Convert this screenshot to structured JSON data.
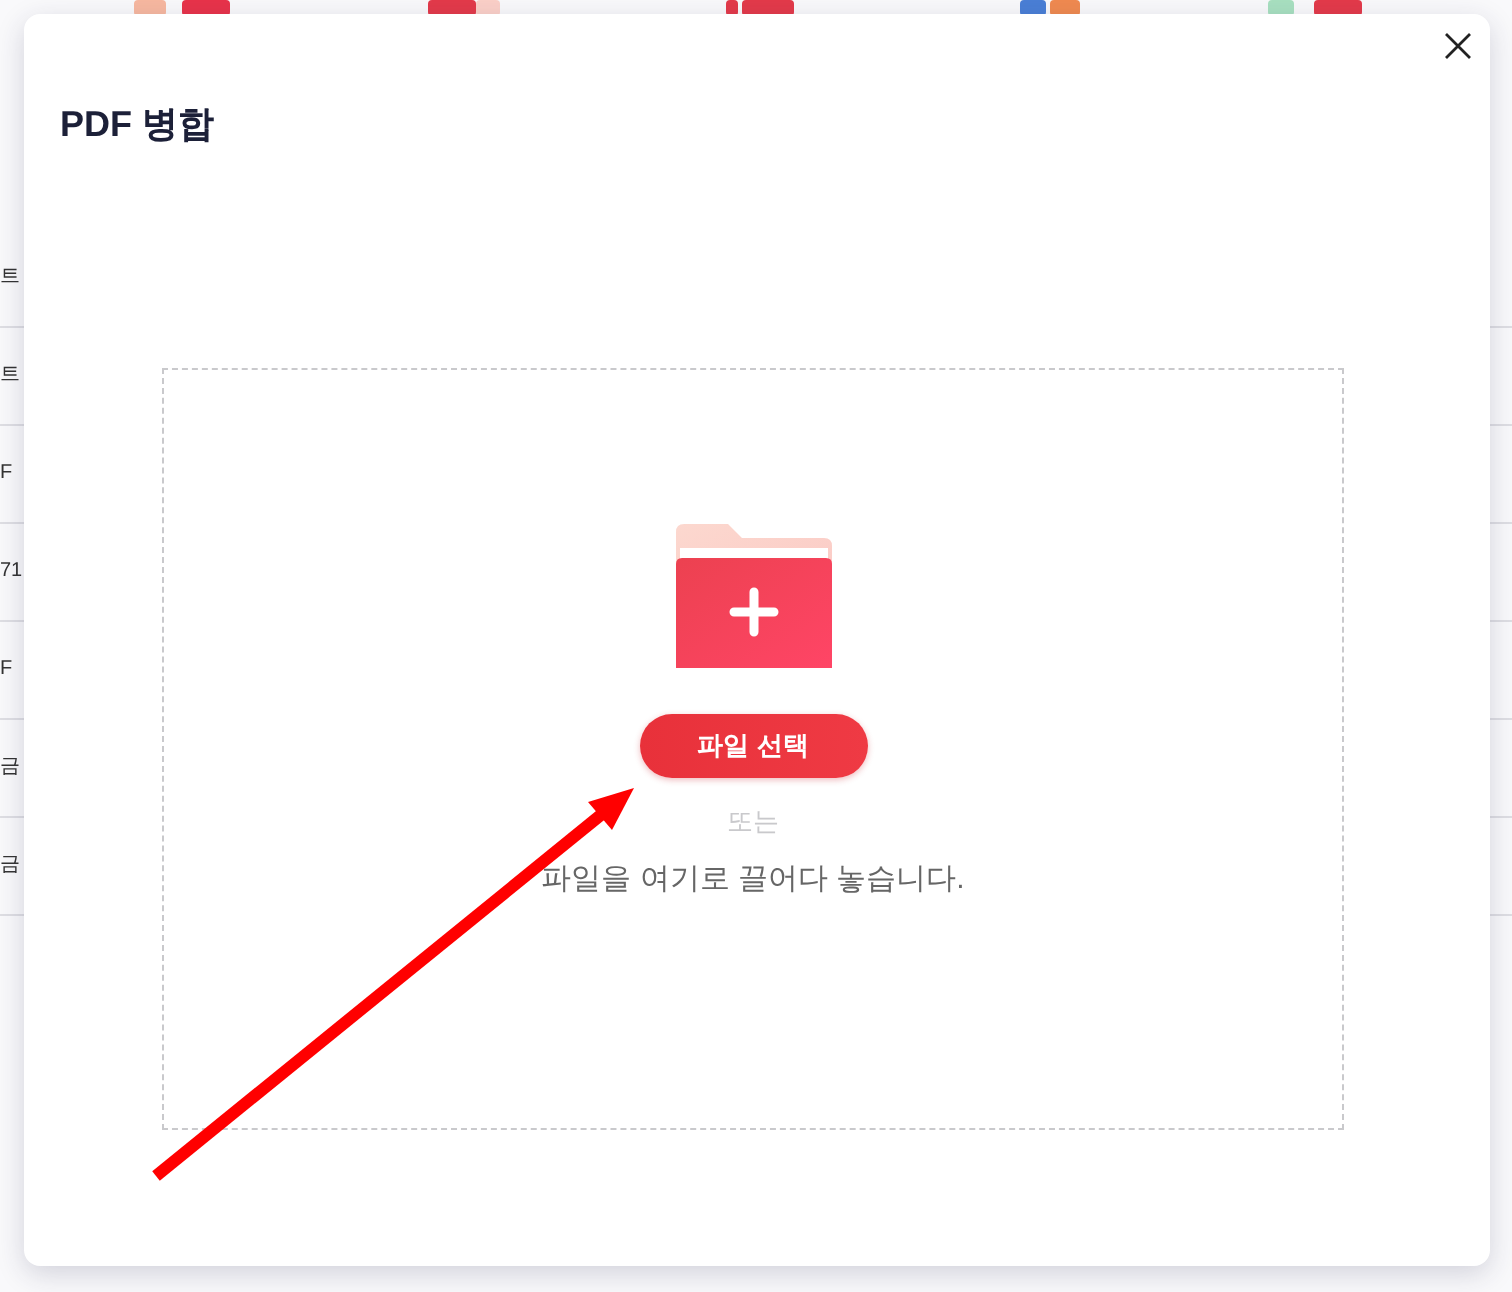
{
  "page_behind": {
    "rows": [
      {
        "text": "트"
      },
      {
        "text": "트"
      },
      {
        "text": "F"
      },
      {
        "text": "71"
      },
      {
        "text": "F"
      },
      {
        "text": "금"
      },
      {
        "text": "금"
      }
    ]
  },
  "dialog": {
    "title": "PDF 병합",
    "drop_zone": {
      "button": "파일 선택",
      "separator": "또는",
      "hint": "파일을 여기로 끌어다 놓습니다."
    }
  }
}
